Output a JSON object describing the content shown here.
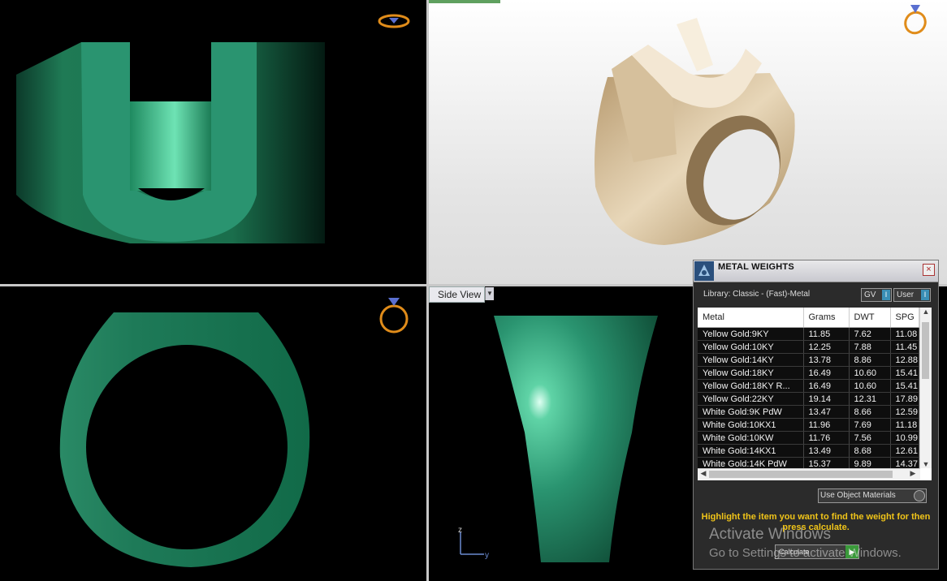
{
  "side_view": {
    "label": "Side View"
  },
  "axis": {
    "z_label": "z",
    "y_label": "y"
  },
  "colors": {
    "ring_green": "#2f9a72",
    "metal_gold": "#d9c3a0",
    "hint_yellow": "#f0c419"
  },
  "icons": {
    "top_nav": "ring-top-icon",
    "persp_nav": "ring-persp-icon",
    "front_nav": "ring-front-icon"
  },
  "metal_weights": {
    "title": "METAL WEIGHTS",
    "library": "Library: Classic - (Fast)-Metal",
    "gv_label": "GV",
    "user_label": "User",
    "columns": [
      "Metal",
      "Grams",
      "DWT",
      "SPG"
    ],
    "rows": [
      [
        "Yellow Gold:9KY",
        "11.85",
        "7.62",
        "11.08"
      ],
      [
        "Yellow Gold:10KY",
        "12.25",
        "7.88",
        "11.45"
      ],
      [
        "Yellow Gold:14KY",
        "13.78",
        "8.86",
        "12.88"
      ],
      [
        "Yellow Gold:18KY",
        "16.49",
        "10.60",
        "15.41"
      ],
      [
        "Yellow Gold:18KY R...",
        "16.49",
        "10.60",
        "15.41"
      ],
      [
        "Yellow Gold:22KY",
        "19.14",
        "12.31",
        "17.89"
      ],
      [
        "White Gold:9K PdW",
        "13.47",
        "8.66",
        "12.59"
      ],
      [
        "White Gold:10KX1",
        "11.96",
        "7.69",
        "11.18"
      ],
      [
        "White Gold:10KW",
        "11.76",
        "7.56",
        "10.99"
      ],
      [
        "White Gold:14KX1",
        "13.49",
        "8.68",
        "12.61"
      ],
      [
        "White Gold:14K PdW",
        "15.37",
        "9.89",
        "14.37"
      ]
    ],
    "use_object_materials": "Use Object Materials",
    "hint": "Highlight the item you want to find the weight for then press calculate.",
    "calculate": "Calculate"
  },
  "watermark": {
    "line1": "Activate Windows",
    "line2": "Go to Settings to activate Windows."
  }
}
